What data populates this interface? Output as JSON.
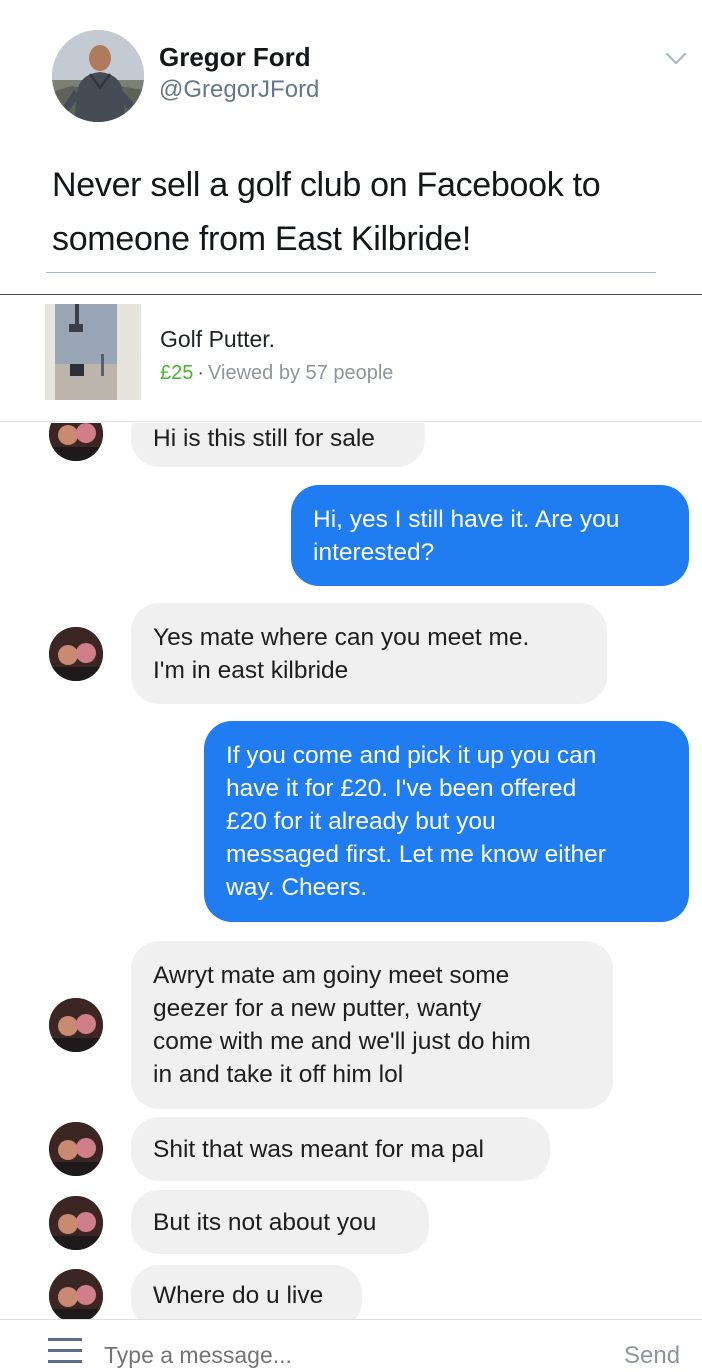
{
  "tweet": {
    "author_name": "Gregor Ford",
    "author_handle": "@GregorJFord",
    "text_line_1": "Never sell a golf club on Facebook to",
    "text_line_2": "someone from East Kilbride!",
    "avatar_icon": "person-avatar",
    "menu_icon": "chevron-down-icon"
  },
  "listing": {
    "title": "Golf Putter.",
    "price": "£25",
    "separator": "·",
    "views": "Viewed by 57 people",
    "thumbnail_icon": "golf-putter-photo"
  },
  "messages": [
    {
      "from": "buyer",
      "lines": [
        "Hi is this still for sale"
      ]
    },
    {
      "from": "seller",
      "lines": [
        "Hi, yes I still have it. Are you",
        "interested?"
      ]
    },
    {
      "from": "buyer",
      "lines": [
        "Yes mate where can you meet me.",
        "I'm in east kilbride"
      ]
    },
    {
      "from": "seller",
      "lines": [
        "If you come and pick it up you can",
        "have it for £20. I've been offered",
        "£20 for it already but you",
        "messaged first. Let me know either",
        "way. Cheers."
      ]
    },
    {
      "from": "buyer",
      "lines": [
        "Awryt mate am goiny meet some",
        "geezer for a new putter, wanty",
        "come with me and we'll just do him",
        "in and take it off him lol"
      ]
    },
    {
      "from": "buyer",
      "lines": [
        "Shit that was meant for ma pal"
      ]
    },
    {
      "from": "buyer",
      "lines": [
        "But its not about you"
      ]
    },
    {
      "from": "buyer",
      "lines": [
        "Where do u live"
      ]
    }
  ],
  "composer": {
    "placeholder": "Type a message...",
    "send_label": "Send",
    "menu_icon": "hamburger-menu-icon"
  },
  "colors": {
    "outgoing_bubble": "#1f7cf1",
    "incoming_bubble": "#f1f0f0",
    "price_green": "#42b72a",
    "handle_gray": "#657786"
  }
}
